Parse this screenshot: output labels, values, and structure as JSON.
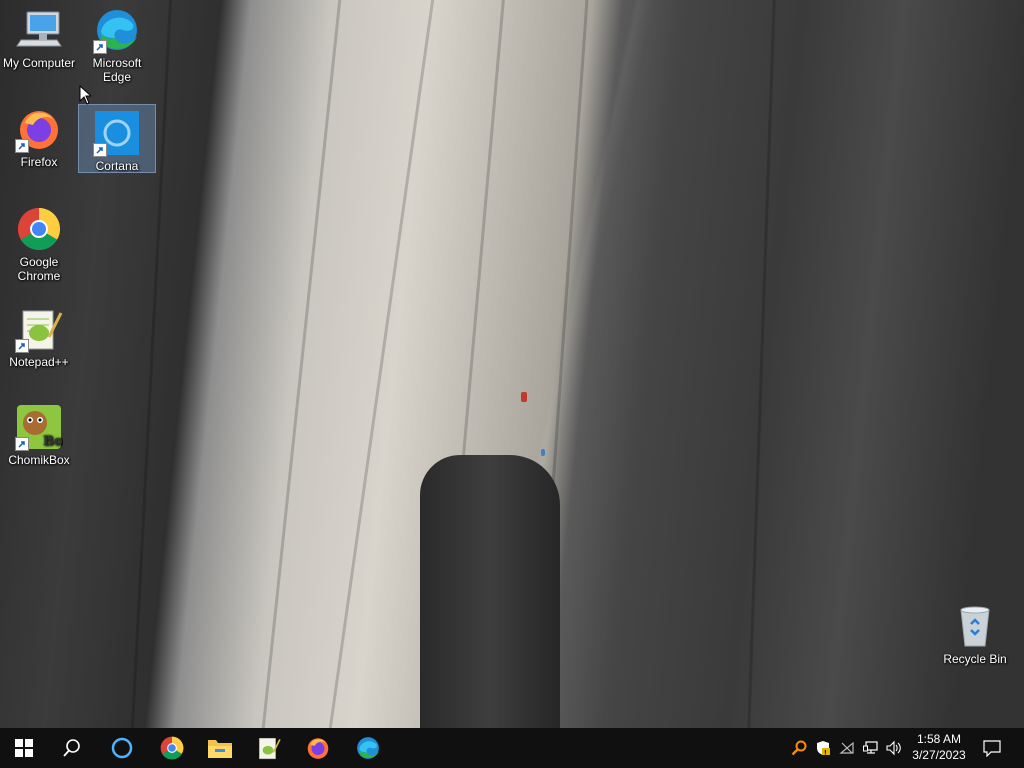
{
  "desktop": {
    "icons": [
      {
        "label": "My Computer",
        "icon": "computer-icon"
      },
      {
        "label": "Microsoft Edge",
        "icon": "edge-icon"
      },
      {
        "label": "Firefox",
        "icon": "firefox-icon"
      },
      {
        "label": "Cortana",
        "icon": "cortana-icon",
        "selected": true
      },
      {
        "label": "Google Chrome",
        "icon": "chrome-icon"
      },
      {
        "label": "Notepad++",
        "icon": "notepadpp-icon"
      },
      {
        "label": "ChomikBox",
        "icon": "chomikbox-icon"
      },
      {
        "label": "Recycle Bin",
        "icon": "recycle-bin-icon"
      }
    ]
  },
  "taskbar": {
    "apps": [
      "start-icon",
      "search-icon",
      "cortana-icon",
      "chrome-icon",
      "file-explorer-icon",
      "notepadpp-icon",
      "firefox-icon",
      "edge-icon"
    ],
    "tray": [
      "search-tool-icon",
      "security-shield-icon",
      "network-disconnected-icon",
      "network-icon",
      "volume-icon"
    ],
    "clock": {
      "time": "1:58 AM",
      "date": "3/27/2023"
    },
    "notification": "action-center-icon"
  },
  "colors": {
    "taskbar": "#101010",
    "selection": "#78aae6",
    "cortana": "#1a8fe0"
  }
}
